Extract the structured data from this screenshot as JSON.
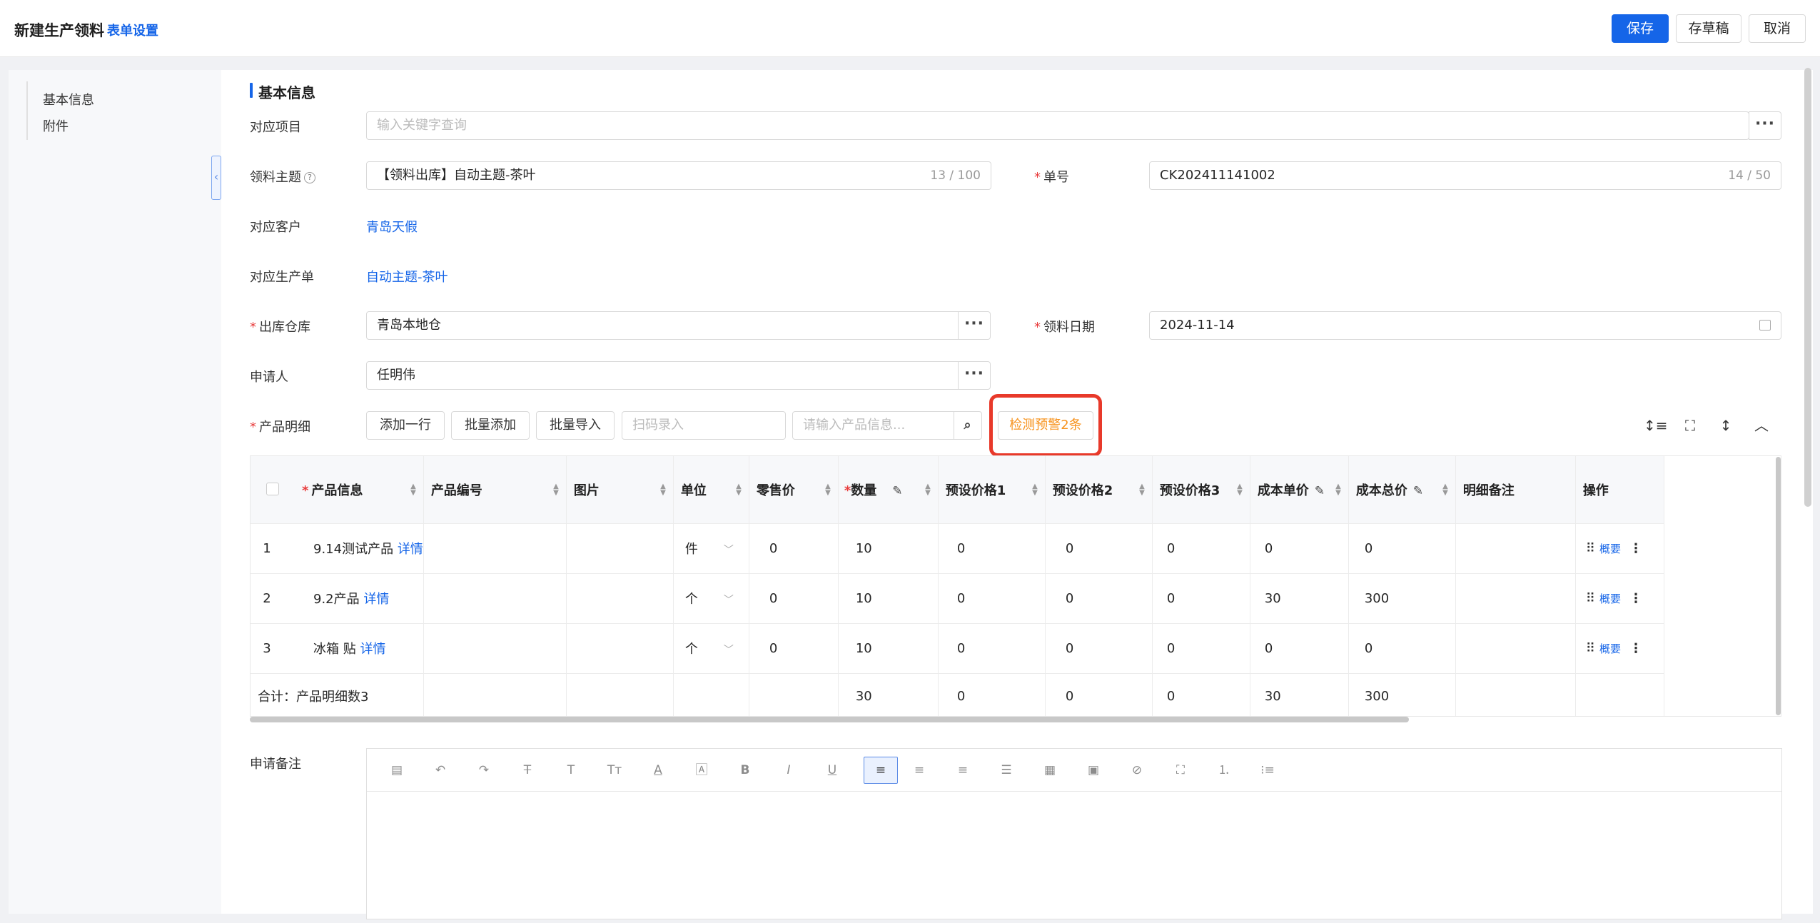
{
  "header": {
    "title": "新建生产领料",
    "form_settings": "表单设置",
    "save": "保存",
    "draft": "存草稿",
    "cancel": "取消"
  },
  "sidebar": {
    "items": [
      {
        "label": "基本信息"
      },
      {
        "label": "附件"
      }
    ]
  },
  "section_title": "基本信息",
  "form": {
    "project": {
      "label": "对应项目",
      "placeholder": "输入关键字查询"
    },
    "subject": {
      "label": "领料主题",
      "value": "【领料出库】自动主题-茶叶",
      "count": "13 / 100"
    },
    "order_no": {
      "label": "单号",
      "value": "CK202411141002",
      "count": "14 / 50"
    },
    "customer": {
      "label": "对应客户",
      "value": "青岛天假"
    },
    "production_order": {
      "label": "对应生产单",
      "value": "自动主题-茶叶"
    },
    "warehouse": {
      "label": "出库仓库",
      "value": "青岛本地仓"
    },
    "date": {
      "label": "领料日期",
      "value": "2024-11-14"
    },
    "applicant": {
      "label": "申请人",
      "value": "任明伟"
    },
    "details_label": "产品明细",
    "remark_label": "申请备注"
  },
  "table_toolbar": {
    "add_row": "添加一行",
    "batch_add": "批量添加",
    "batch_import": "批量导入",
    "scan_placeholder": "扫码录入",
    "product_placeholder": "请输入产品信息...",
    "check_warning": "检测预警2条"
  },
  "table": {
    "headers": [
      "产品信息",
      "产品编号",
      "图片",
      "单位",
      "零售价",
      "数量",
      "预设价格1",
      "预设价格2",
      "预设价格3",
      "成本单价",
      "成本总价",
      "明细备注",
      "操作"
    ],
    "rows": [
      {
        "idx": "1",
        "product": "9.14测试产品",
        "detail": "详情",
        "code": "",
        "unit": "件",
        "retail": "0",
        "qty": "10",
        "p1": "0",
        "p2": "0",
        "p3": "0",
        "cost": "0",
        "total": "0",
        "note": "",
        "op": "概要"
      },
      {
        "idx": "2",
        "product": "9.2产品",
        "detail": "详情",
        "code": "",
        "unit": "个",
        "retail": "0",
        "qty": "10",
        "p1": "0",
        "p2": "0",
        "p3": "0",
        "cost": "30",
        "total": "300",
        "note": "",
        "op": "概要"
      },
      {
        "idx": "3",
        "product": "冰箱 贴",
        "detail": "详情",
        "code": "",
        "unit": "个",
        "retail": "0",
        "qty": "10",
        "p1": "0",
        "p2": "0",
        "p3": "0",
        "cost": "0",
        "total": "0",
        "note": "",
        "op": "概要"
      }
    ],
    "total": {
      "label": "合计：产品明细数3",
      "qty": "30",
      "p1": "0",
      "p2": "0",
      "p3": "0",
      "cost": "30",
      "total": "300"
    }
  },
  "colors": {
    "primary": "#1565e8",
    "warning": "#f7931e",
    "highlight": "#e8392a",
    "required": "#e83a3a"
  }
}
